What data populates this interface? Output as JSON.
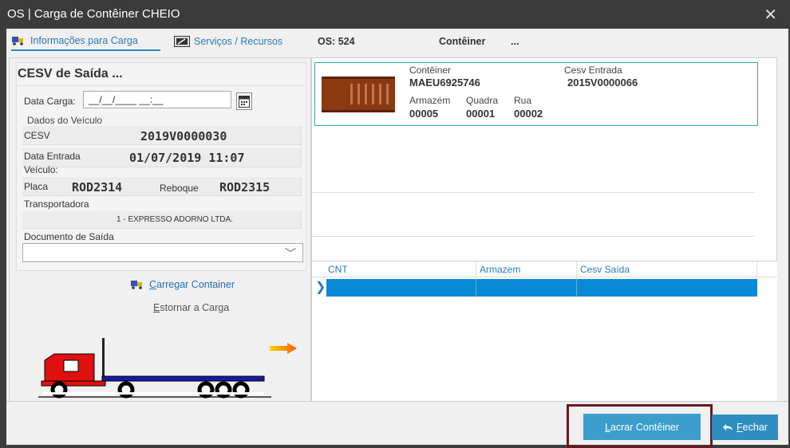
{
  "window": {
    "title": "OS | Carga de Contêiner CHEIO",
    "close_glyph": "✕"
  },
  "tabs": {
    "info": "Informações para Carga",
    "services": "Serviços / Recursos",
    "os_label": "OS: 524",
    "container_label": "Contêiner",
    "container_value": "..."
  },
  "cesv": {
    "title": "CESV de Saída ...",
    "data_carga_label": "Data Carga:",
    "data_carga_placeholder": "__/__/____ __:__",
    "dados_veiculo": "Dados do Veículo",
    "cesv_label": "CESV",
    "cesv_value": "2019V0000030",
    "data_entrada_label": "Data Entrada",
    "data_entrada_value": "01/07/2019 11:07",
    "veiculo_label": "Veículo:",
    "placa_label": "Placa",
    "placa_value": "ROD2314",
    "reboque_label": "Reboque",
    "reboque_value": "ROD2315",
    "transportadora_label": "Transportadora",
    "transportadora_value": "1 - EXPRESSO ADORNO LTDA.",
    "documento_label": "Documento de Saída",
    "documento_value": ""
  },
  "actions": {
    "carregar": "Carregar Container",
    "carregar_accel": "C",
    "carregar_rest": "arregar Container",
    "estornar": "Estornar a Carga",
    "estornar_accel": "E",
    "estornar_rest": "stornar a Carga"
  },
  "container_card": {
    "container_label": "Contêiner",
    "container_value": "MAEU6925746",
    "cesv_entrada_label": "Cesv Entrada",
    "cesv_entrada_value": "2015V0000066",
    "armazem_label": "Armazém",
    "armazem_value": "00005",
    "quadra_label": "Quadra",
    "quadra_value": "00001",
    "rua_label": "Rua",
    "rua_value": "00002"
  },
  "grid": {
    "columns": [
      "CNT",
      "Armazem",
      "Cesv Saída"
    ],
    "rows": [
      {
        "cnt": "",
        "armazem": "",
        "cesv_saida": ""
      }
    ]
  },
  "buttons": {
    "lacrar": "Lacrar Contêiner",
    "lacrar_accel": "L",
    "lacrar_rest": "acrar Contêiner",
    "fechar": "Fechar",
    "fechar_accel": "F",
    "fechar_rest": "echar"
  },
  "colors": {
    "accent": "#3c9ecc",
    "title_bar": "#3b3b3b",
    "grid_selection": "#0a8ad6",
    "truck_cab": "#e01010",
    "trailer": "#1a1a9e",
    "highlight": "#6a1823",
    "container_rust": "#8a3a12"
  }
}
